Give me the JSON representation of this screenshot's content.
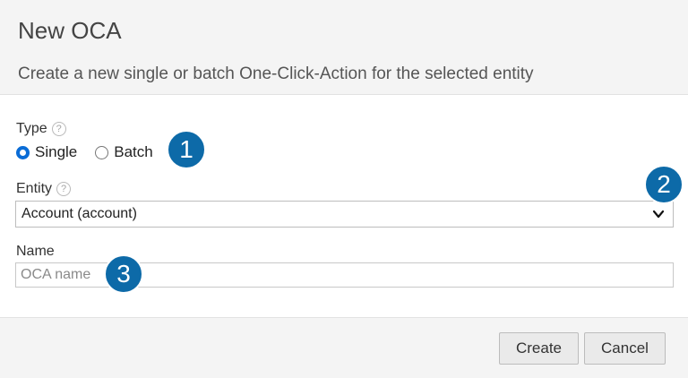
{
  "dialog": {
    "title": "New OCA",
    "subtitle": "Create a new single or batch One-Click-Action for the selected entity"
  },
  "form": {
    "type": {
      "label": "Type",
      "help": "?",
      "options": [
        {
          "label": "Single",
          "checked": true
        },
        {
          "label": "Batch",
          "checked": false
        }
      ]
    },
    "entity": {
      "label": "Entity",
      "help": "?",
      "selected": "Account (account)"
    },
    "name": {
      "label": "Name",
      "value": "",
      "placeholder": "OCA name"
    }
  },
  "footer": {
    "create_label": "Create",
    "cancel_label": "Cancel"
  },
  "callouts": [
    "1",
    "2",
    "3"
  ],
  "colors": {
    "accent": "#0a6cd6",
    "callout": "#0d6aa8",
    "header_bg": "#f4f4f4"
  }
}
